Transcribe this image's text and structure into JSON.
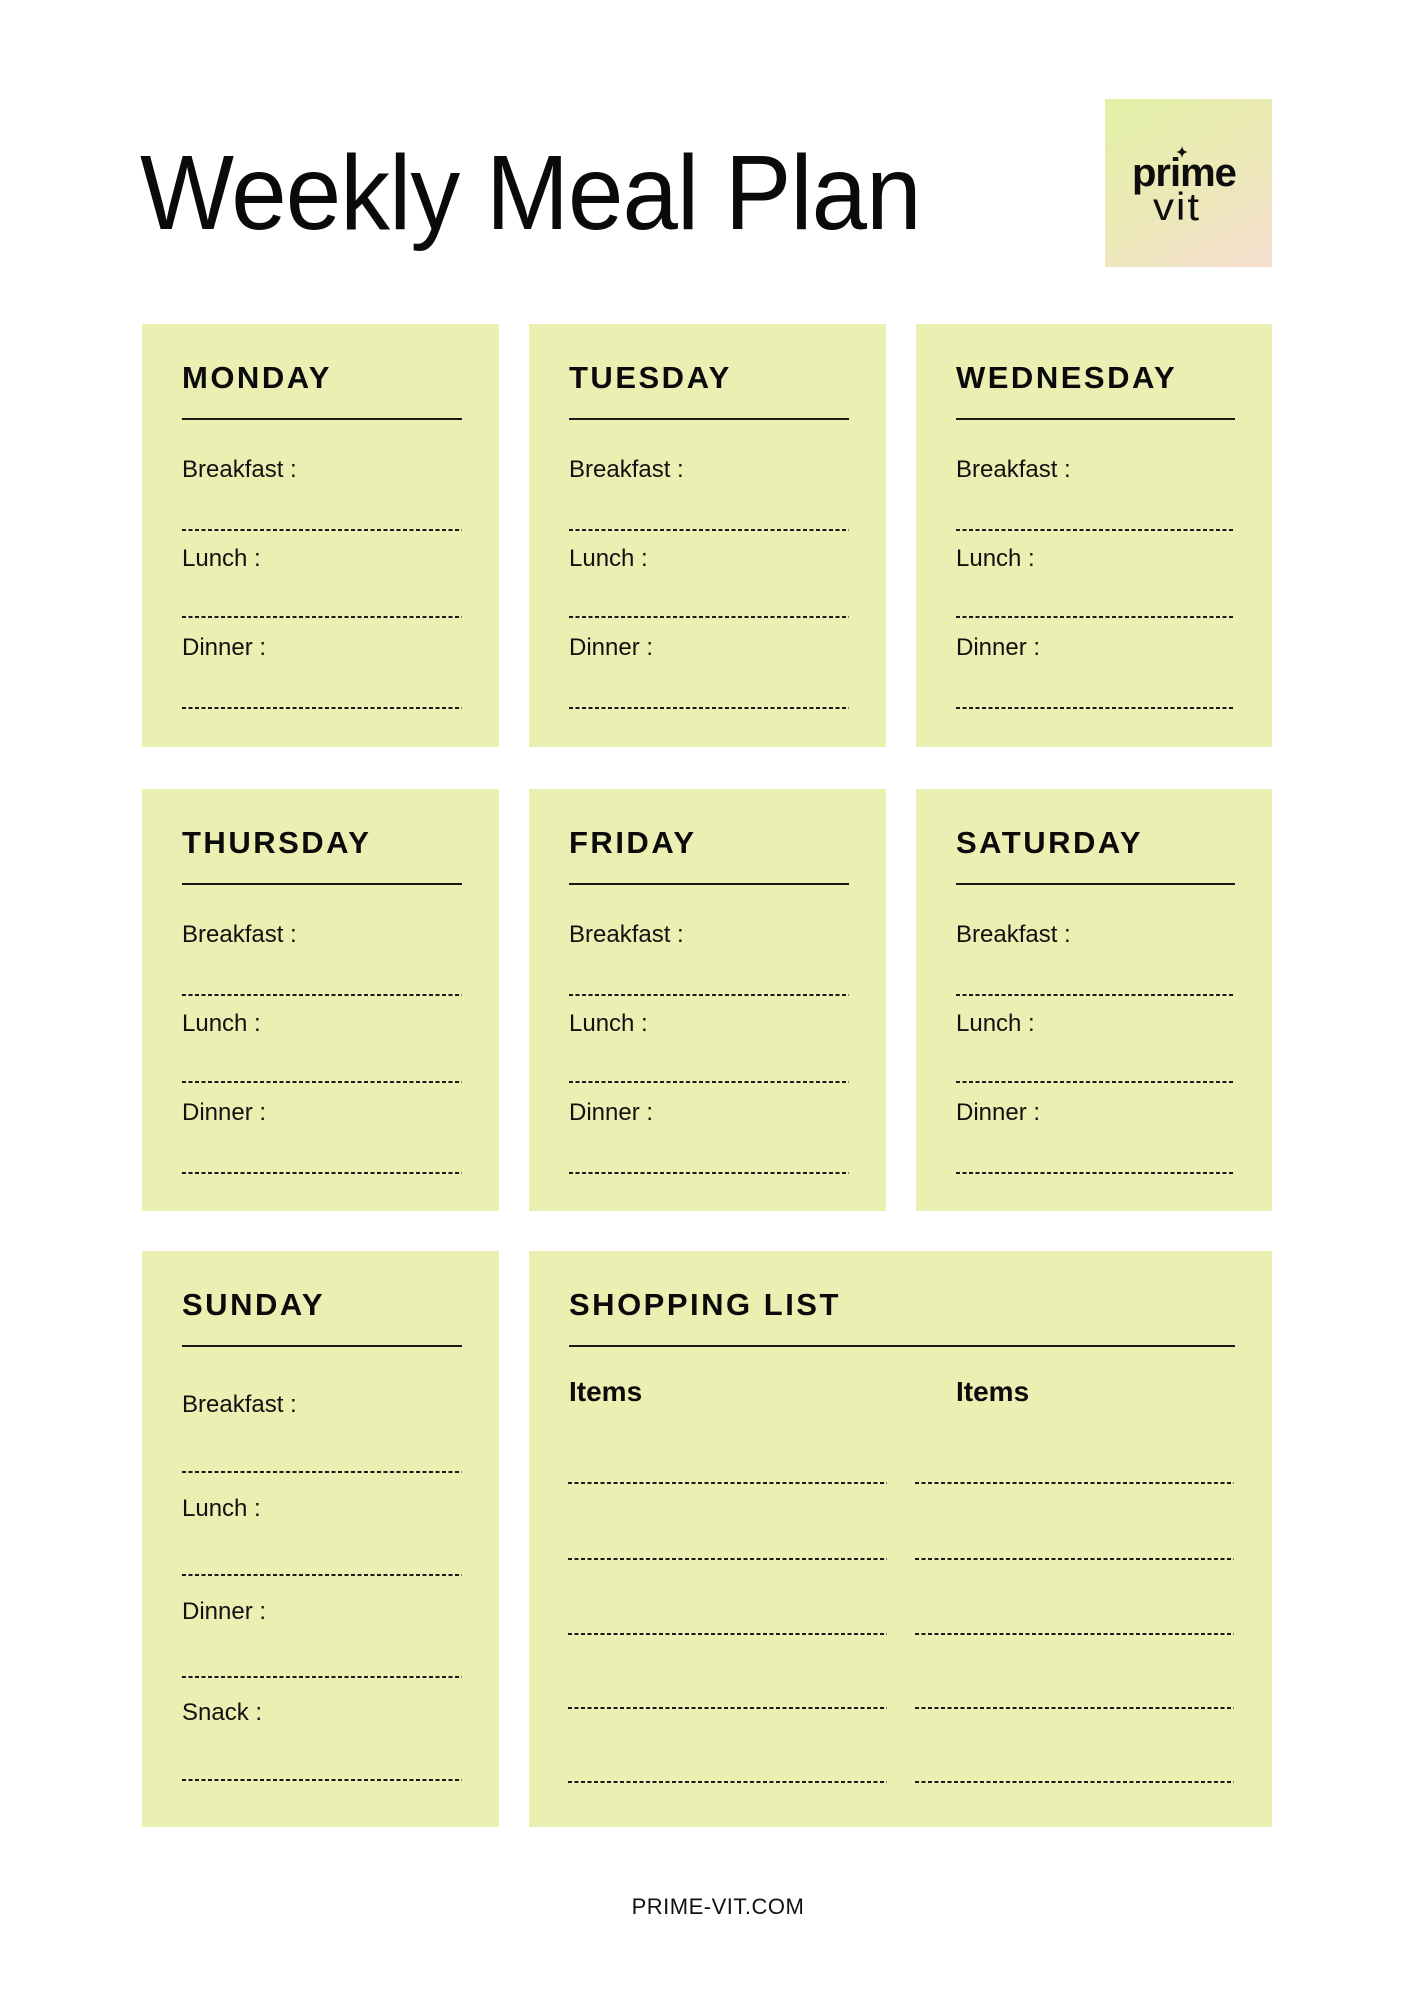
{
  "header": {
    "title": "Weekly Meal Plan",
    "logo": {
      "line1": "prime",
      "line2": "vit",
      "icon": "sparkle-star-icon"
    }
  },
  "colors": {
    "card_background": "#ebefb2",
    "text": "#111111",
    "logo_gradient_start": "#e3f0a6",
    "logo_gradient_end": "#f6dfd2"
  },
  "days": [
    {
      "name": "MONDAY",
      "meals": [
        "Breakfast :",
        "Lunch :",
        "Dinner :"
      ]
    },
    {
      "name": "TUESDAY",
      "meals": [
        "Breakfast :",
        "Lunch :",
        "Dinner :"
      ]
    },
    {
      "name": "WEDNESDAY",
      "meals": [
        "Breakfast :",
        "Lunch :",
        "Dinner :"
      ]
    },
    {
      "name": "THURSDAY",
      "meals": [
        "Breakfast :",
        "Lunch :",
        "Dinner :"
      ]
    },
    {
      "name": "FRIDAY",
      "meals": [
        "Breakfast :",
        "Lunch :",
        "Dinner :"
      ]
    },
    {
      "name": "SATURDAY",
      "meals": [
        "Breakfast :",
        "Lunch :",
        "Dinner :"
      ]
    },
    {
      "name": "SUNDAY",
      "meals": [
        "Breakfast :",
        "Lunch :",
        "Dinner :",
        "Snack :"
      ]
    }
  ],
  "shopping_list": {
    "title": "SHOPPING LIST",
    "columns": [
      {
        "heading": "Items",
        "blank_lines": 5
      },
      {
        "heading": "Items",
        "blank_lines": 5
      }
    ]
  },
  "footer": {
    "website": "PRIME-VIT.COM"
  }
}
